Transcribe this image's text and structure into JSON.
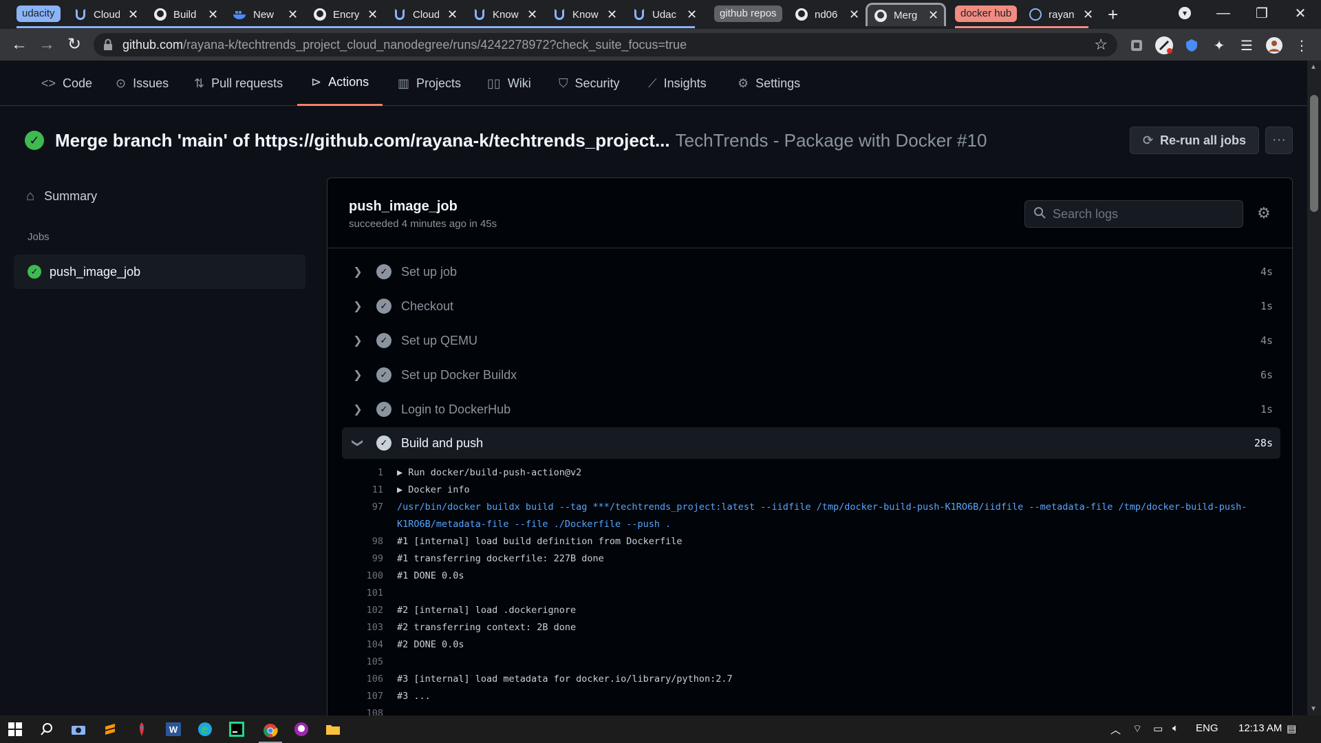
{
  "browser": {
    "tabs": [
      {
        "group": "udacity",
        "title": "Cloud",
        "icon": "udacity-icon"
      },
      {
        "title": "Build",
        "icon": "github-icon"
      },
      {
        "title": "New",
        "icon": "docker-icon"
      },
      {
        "title": "Encry",
        "icon": "github-icon"
      },
      {
        "title": "Cloud",
        "icon": "udacity-icon"
      },
      {
        "title": "Know",
        "icon": "udacity-icon"
      },
      {
        "title": "Know",
        "icon": "udacity-icon"
      },
      {
        "title": "Udac",
        "icon": "udacity-icon"
      },
      {
        "group": "github repos",
        "title": "nd06",
        "icon": "github-icon"
      },
      {
        "title": "Merg",
        "icon": "github-icon",
        "active": true
      },
      {
        "group": "docker hub",
        "title": "rayan",
        "icon": "docker-icon"
      }
    ],
    "groups": [
      {
        "label": "udacity",
        "color": "#8ab4f8"
      },
      {
        "label": "github repos",
        "color": "#9aa0a6"
      },
      {
        "label": "docker hub",
        "color": "#f28b82"
      }
    ],
    "new_tab": "+",
    "address": {
      "host": "github.com",
      "path": "/rayana-k/techtrends_project_cloud_nanodegree/runs/4242278972?check_suite_focus=true"
    }
  },
  "repo_nav": {
    "items": [
      {
        "label": "Code",
        "icon": "code-icon"
      },
      {
        "label": "Issues",
        "icon": "issue-icon"
      },
      {
        "label": "Pull requests",
        "icon": "pull-request-icon"
      },
      {
        "label": "Actions",
        "icon": "play-icon",
        "selected": true
      },
      {
        "label": "Projects",
        "icon": "project-icon"
      },
      {
        "label": "Wiki",
        "icon": "book-icon"
      },
      {
        "label": "Security",
        "icon": "shield-icon"
      },
      {
        "label": "Insights",
        "icon": "graph-icon"
      },
      {
        "label": "Settings",
        "icon": "gear-icon"
      }
    ]
  },
  "run": {
    "title": "Merge branch 'main' of https://github.com/rayana-k/techtrends_project...",
    "workflow": "TechTrends - Package with Docker #10",
    "rerun_label": "Re-run all jobs",
    "status_color": "#3fb950"
  },
  "sidebar": {
    "summary_label": "Summary",
    "jobs_heading": "Jobs",
    "job_label": "push_image_job"
  },
  "job": {
    "name": "push_image_job",
    "status": "succeeded 4 minutes ago in 45s",
    "search_placeholder": "Search logs",
    "steps": [
      {
        "label": "Set up job",
        "duration": "4s"
      },
      {
        "label": "Checkout",
        "duration": "1s"
      },
      {
        "label": "Set up QEMU",
        "duration": "4s"
      },
      {
        "label": "Set up Docker Buildx",
        "duration": "6s"
      },
      {
        "label": "Login to DockerHub",
        "duration": "1s"
      },
      {
        "label": "Build and push",
        "duration": "28s",
        "expanded": true
      }
    ],
    "log_lines": [
      {
        "num": "1",
        "text": "▶ Run docker/build-push-action@v2",
        "kind": "grp"
      },
      {
        "num": "11",
        "text": "▶ Docker info",
        "kind": "grp"
      },
      {
        "num": "97",
        "text": "/usr/bin/docker buildx build --tag ***/techtrends_project:latest --iidfile /tmp/docker-build-push-K1RO6B/iidfile --metadata-file /tmp/docker-build-push-",
        "kind": "cmd"
      },
      {
        "num": "",
        "text": "K1RO6B/metadata-file --file ./Dockerfile --push .",
        "kind": "cmd"
      },
      {
        "num": "98",
        "text": "#1 [internal] load build definition from Dockerfile",
        "kind": "out"
      },
      {
        "num": "99",
        "text": "#1 transferring dockerfile: 227B done",
        "kind": "out"
      },
      {
        "num": "100",
        "text": "#1 DONE 0.0s",
        "kind": "out"
      },
      {
        "num": "101",
        "text": "",
        "kind": "out"
      },
      {
        "num": "102",
        "text": "#2 [internal] load .dockerignore",
        "kind": "out"
      },
      {
        "num": "103",
        "text": "#2 transferring context: 2B done",
        "kind": "out"
      },
      {
        "num": "104",
        "text": "#2 DONE 0.0s",
        "kind": "out"
      },
      {
        "num": "105",
        "text": "",
        "kind": "out"
      },
      {
        "num": "106",
        "text": "#3 [internal] load metadata for docker.io/library/python:2.7",
        "kind": "out"
      },
      {
        "num": "107",
        "text": "#3 ...",
        "kind": "out"
      },
      {
        "num": "108",
        "text": "",
        "kind": "out"
      }
    ]
  },
  "taskbar": {
    "language": "ENG",
    "time": "12:13 AM"
  }
}
